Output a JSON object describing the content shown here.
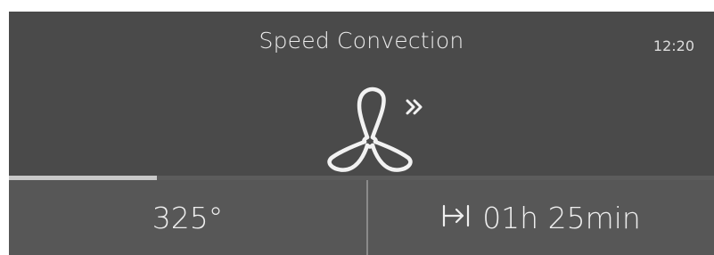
{
  "header": {
    "title": "Speed Convection",
    "clock": "12:20",
    "mode_icon": "fan-speed-icon"
  },
  "progress": {
    "fraction": 0.21
  },
  "settings": {
    "temperature": "325°",
    "timer_icon": "timer-end-icon",
    "duration": "01h 25min"
  },
  "colors": {
    "background": "#4a4a4a",
    "panel": "#575757",
    "text": "#eeeeee",
    "progress_fill": "#c9c9c9"
  }
}
